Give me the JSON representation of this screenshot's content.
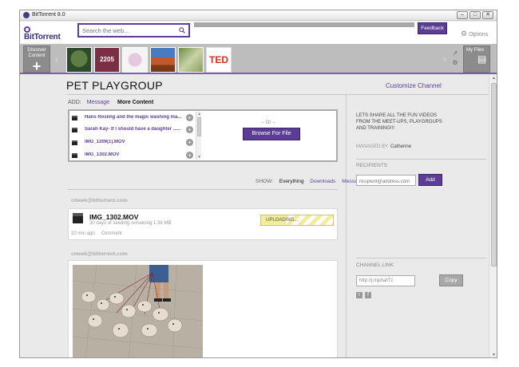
{
  "window": {
    "title": "BitTorrent 8.0",
    "min_glyph": "–",
    "max_glyph": "□",
    "close_glyph": "✕"
  },
  "header": {
    "logo_text": "BitTorrent",
    "search_placeholder": "Search the web...",
    "feedback_label": "Feedback",
    "options_label": "Options"
  },
  "channels": {
    "discover_label": "Discover Content",
    "discover_plus": "+",
    "thumb_2205": "2205",
    "thumb_ted": "TED",
    "my_files_label": "My Files"
  },
  "channel": {
    "title": "PET PLAYGROUP",
    "customize_label": "Customize Channel"
  },
  "add": {
    "label": "ADD:",
    "tab_message": "Message",
    "tab_more": "More Content",
    "files": [
      "Hans Rosling and the magic washing ma...",
      "Sarah Kay- If I should have a daughter ......",
      "IMG_1309(1).MOV",
      "IMG_1302.MOV"
    ],
    "or_text": "-- Or --",
    "browse_label": "Browse For File"
  },
  "show": {
    "label": "SHOW:",
    "everything": "Everything",
    "downloads": "Downloads",
    "messages": "Messages"
  },
  "posts": [
    {
      "author": "cmeek@bittorrent.com",
      "title": "IMG_1302.MOV",
      "subtitle": "30 days of seeding remaining   1.38 MB",
      "status": "UPLOADING...",
      "progress": 0.34,
      "time": "10 min ago",
      "comment_label": "Comment"
    },
    {
      "author": "cmeek@bittorrent.com"
    }
  ],
  "sidebar": {
    "promo": "LETS SHARE ALL THE FUN VIDEOS FROM THE MEET-UPS, PLAYGROUPS AND TRAINING!!!",
    "managed_label": "MANAGED BY",
    "managed_name": "Catherine",
    "recipients_heading": "RECIPIENTS",
    "recipient_placeholder": "recipient@address.com",
    "add_label": "Add",
    "channel_link_heading": "CHANNEL LINK",
    "channel_link_value": "http://j.mp/tallTz",
    "copy_label": "Copy"
  }
}
